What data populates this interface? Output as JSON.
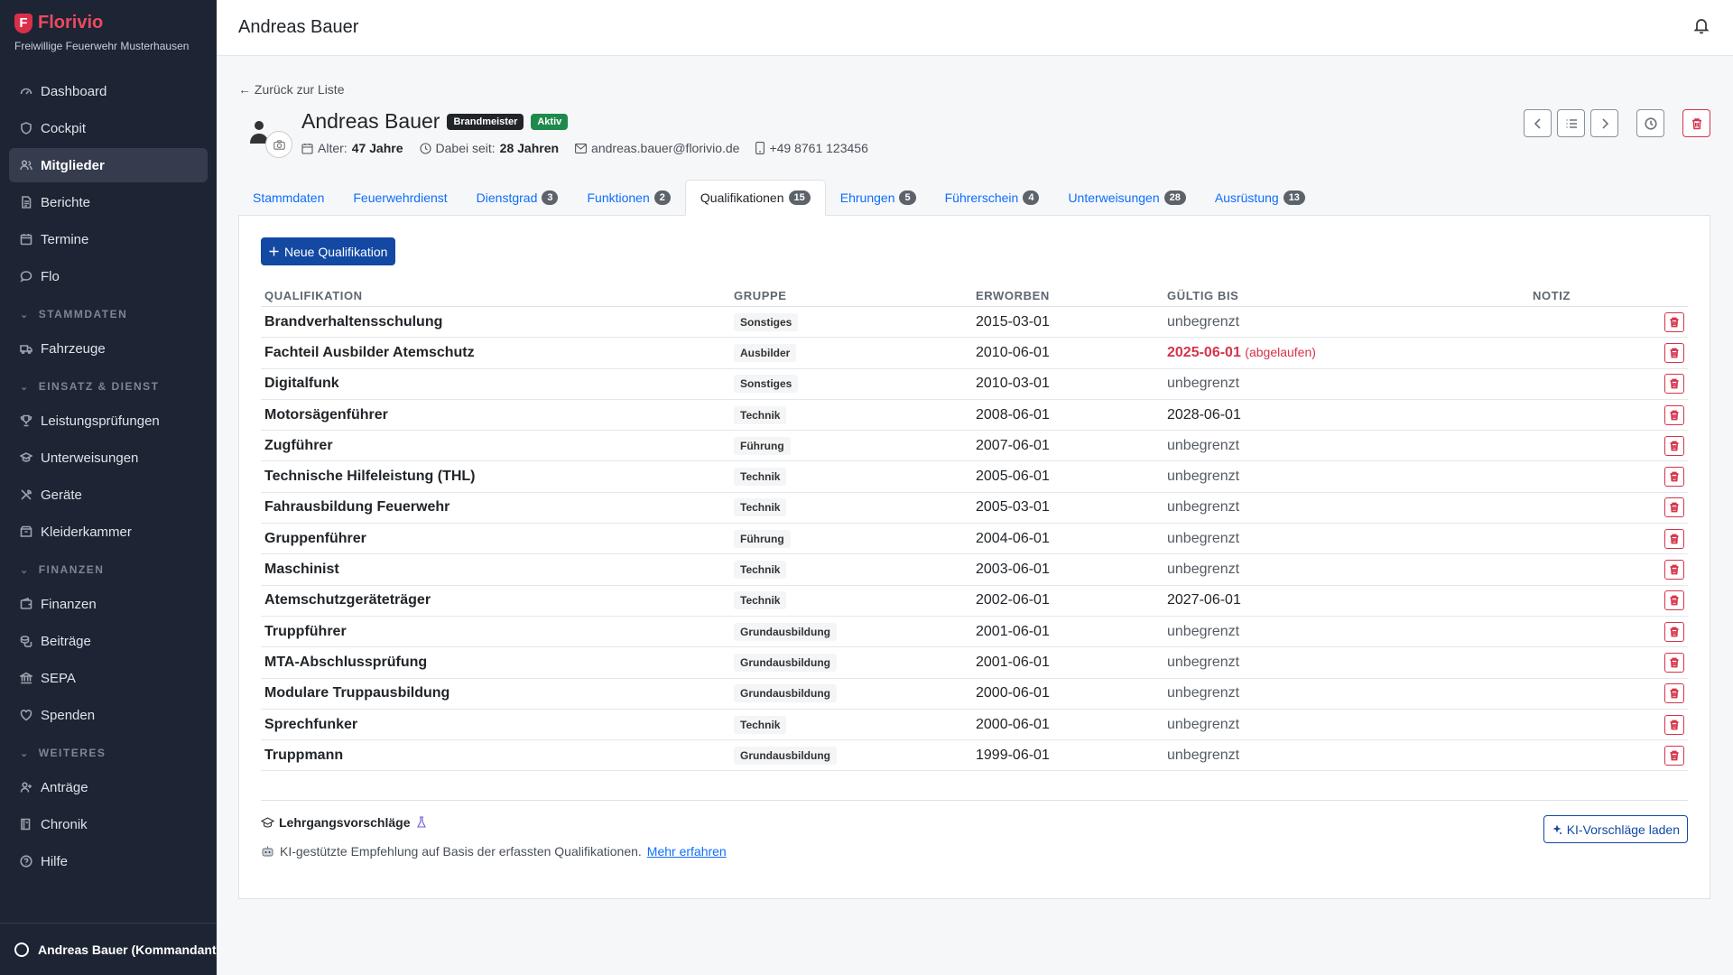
{
  "brand": {
    "name": "Florivio",
    "logo_letter": "F",
    "subtitle": "Freiwillige Feuerwehr Musterhausen"
  },
  "nav": {
    "top": [
      {
        "label": "Dashboard",
        "icon": "dashboard-icon"
      },
      {
        "label": "Cockpit",
        "icon": "shield-icon"
      },
      {
        "label": "Mitglieder",
        "icon": "users-icon",
        "active": true
      },
      {
        "label": "Berichte",
        "icon": "document-icon"
      },
      {
        "label": "Termine",
        "icon": "calendar-icon"
      },
      {
        "label": "Flo",
        "icon": "chat-icon"
      }
    ],
    "sections": [
      {
        "title": "STAMMDATEN",
        "items": [
          {
            "label": "Fahrzeuge",
            "icon": "truck-icon"
          }
        ]
      },
      {
        "title": "EINSATZ & DIENST",
        "items": [
          {
            "label": "Leistungsprüfungen",
            "icon": "trophy-icon"
          },
          {
            "label": "Unterweisungen",
            "icon": "graduation-icon"
          },
          {
            "label": "Geräte",
            "icon": "tools-icon"
          },
          {
            "label": "Kleiderkammer",
            "icon": "box-icon"
          }
        ]
      },
      {
        "title": "FINANZEN",
        "items": [
          {
            "label": "Finanzen",
            "icon": "wallet-icon"
          },
          {
            "label": "Beiträge",
            "icon": "coins-icon"
          },
          {
            "label": "SEPA",
            "icon": "bank-icon"
          },
          {
            "label": "Spenden",
            "icon": "heart-icon"
          }
        ]
      },
      {
        "title": "WEITERES",
        "items": [
          {
            "label": "Anträge",
            "icon": "person-plus-icon"
          },
          {
            "label": "Chronik",
            "icon": "book-icon"
          },
          {
            "label": "Hilfe",
            "icon": "help-icon"
          }
        ]
      }
    ]
  },
  "footer": {
    "user": "Andreas Bauer (Kommandant)"
  },
  "header": {
    "title": "Andreas Bauer"
  },
  "back_link": "← Zurück zur Liste",
  "profile": {
    "name": "Andreas Bauer",
    "rank_badge": "Brandmeister",
    "status_badge": "Aktiv",
    "age_label": "Alter:",
    "age_value": "47 Jahre",
    "since_label": "Dabei seit:",
    "since_value": "28 Jahren",
    "email": "andreas.bauer@florivio.de",
    "phone": "+49 8761 123456"
  },
  "tabs": [
    {
      "label": "Stammdaten",
      "count": null
    },
    {
      "label": "Feuerwehrdienst",
      "count": null
    },
    {
      "label": "Dienstgrad",
      "count": "3"
    },
    {
      "label": "Funktionen",
      "count": "2"
    },
    {
      "label": "Qualifikationen",
      "count": "15",
      "active": true
    },
    {
      "label": "Ehrungen",
      "count": "5"
    },
    {
      "label": "Führerschein",
      "count": "4"
    },
    {
      "label": "Unterweisungen",
      "count": "28"
    },
    {
      "label": "Ausrüstung",
      "count": "13"
    }
  ],
  "new_button": "Neue Qualifikation",
  "table": {
    "headers": [
      "QUALIFIKATION",
      "GRUPPE",
      "ERWORBEN",
      "GÜLTIG BIS",
      "NOTIZ"
    ],
    "rows": [
      {
        "name": "Brandverhaltensschulung",
        "group": "Sonstiges",
        "acquired": "2015-03-01",
        "valid": "unbegrenzt"
      },
      {
        "name": "Fachteil Ausbilder Atemschutz",
        "group": "Ausbilder",
        "acquired": "2010-06-01",
        "valid": "2025-06-01",
        "expired_label": "(abgelaufen)"
      },
      {
        "name": "Digitalfunk",
        "group": "Sonstiges",
        "acquired": "2010-03-01",
        "valid": "unbegrenzt"
      },
      {
        "name": "Motorsägenführer",
        "group": "Technik",
        "acquired": "2008-06-01",
        "valid": "2028-06-01"
      },
      {
        "name": "Zugführer",
        "group": "Führung",
        "acquired": "2007-06-01",
        "valid": "unbegrenzt"
      },
      {
        "name": "Technische Hilfeleistung (THL)",
        "group": "Technik",
        "acquired": "2005-06-01",
        "valid": "unbegrenzt"
      },
      {
        "name": "Fahrausbildung Feuerwehr",
        "group": "Technik",
        "acquired": "2005-03-01",
        "valid": "unbegrenzt"
      },
      {
        "name": "Gruppenführer",
        "group": "Führung",
        "acquired": "2004-06-01",
        "valid": "unbegrenzt"
      },
      {
        "name": "Maschinist",
        "group": "Technik",
        "acquired": "2003-06-01",
        "valid": "unbegrenzt"
      },
      {
        "name": "Atemschutzgeräteträger",
        "group": "Technik",
        "acquired": "2002-06-01",
        "valid": "2027-06-01"
      },
      {
        "name": "Truppführer",
        "group": "Grundausbildung",
        "acquired": "2001-06-01",
        "valid": "unbegrenzt"
      },
      {
        "name": "MTA-Abschlussprüfung",
        "group": "Grundausbildung",
        "acquired": "2001-06-01",
        "valid": "unbegrenzt"
      },
      {
        "name": "Modulare Truppausbildung",
        "group": "Grundausbildung",
        "acquired": "2000-06-01",
        "valid": "unbegrenzt"
      },
      {
        "name": "Sprechfunker",
        "group": "Technik",
        "acquired": "2000-06-01",
        "valid": "unbegrenzt"
      },
      {
        "name": "Truppmann",
        "group": "Grundausbildung",
        "acquired": "1999-06-01",
        "valid": "unbegrenzt"
      }
    ]
  },
  "suggestions": {
    "title": "Lehrgangsvorschläge",
    "description": "KI-gestützte Empfehlung auf Basis der erfassten Qualifikationen.",
    "link": "Mehr erfahren",
    "button": "KI-Vorschläge laden"
  },
  "colors": {
    "sidebar": "#1d2433",
    "brand": "#ea4a5f",
    "primary": "#1348a3",
    "danger": "#d6334a",
    "success": "#1e8a4d"
  }
}
